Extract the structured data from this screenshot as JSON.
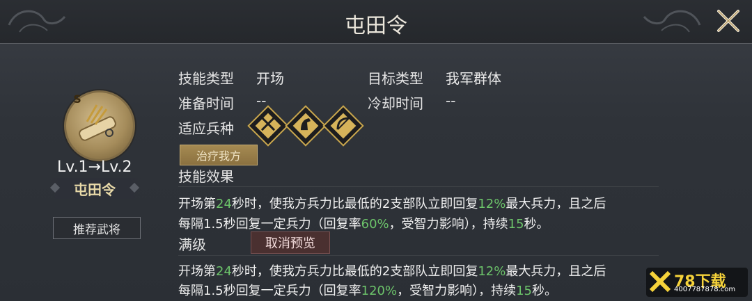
{
  "header": {
    "title": "屯田令"
  },
  "hero": {
    "level_text": "Lv.1→Lv.2",
    "name": "屯田令",
    "recommend_button": "推荐武将",
    "badge_letter": "S"
  },
  "details": {
    "skill_type_label": "技能类型",
    "skill_type_value": "开场",
    "target_type_label": "目标类型",
    "target_type_value": "我军群体",
    "prep_time_label": "准备时间",
    "prep_time_value": "--",
    "cooldown_label": "冷却时间",
    "cooldown_value": "--",
    "troop_label": "适应兵种",
    "troop_icons": [
      "spear-icon",
      "cavalry-icon",
      "bow-icon"
    ]
  },
  "tag": "治疗我方",
  "effect": {
    "label": "技能效果",
    "line1": [
      {
        "t": "开场第"
      },
      {
        "t": "24",
        "hl": true
      },
      {
        "t": "秒时，使我方兵力比最低的2支部队立即回复"
      },
      {
        "t": "12%",
        "hl": true
      },
      {
        "t": "最大兵力，且之后"
      }
    ],
    "line2": [
      {
        "t": "每隔1.5秒回复一定兵力（回复率"
      },
      {
        "t": "60%",
        "hl": true
      },
      {
        "t": "，受智力影响），持续"
      },
      {
        "t": "15",
        "hl": true
      },
      {
        "t": "秒。"
      }
    ]
  },
  "maxlevel": {
    "label": "满级",
    "cancel_button": "取消预览",
    "line1": [
      {
        "t": "开场第"
      },
      {
        "t": "24",
        "hl": true
      },
      {
        "t": "秒时，使我方兵力比最低的2支部队立即回复"
      },
      {
        "t": "12%",
        "hl": true
      },
      {
        "t": "最大兵力，且之后"
      }
    ],
    "line2": [
      {
        "t": "每隔1.5秒回复一定兵力（回复率"
      },
      {
        "t": "120%",
        "hl": true
      },
      {
        "t": "，受智力影响），持续"
      },
      {
        "t": "15",
        "hl": true
      },
      {
        "t": "秒。"
      }
    ]
  },
  "colors": {
    "highlight": "#6cc36a",
    "gold": "#c9a74e"
  },
  "watermark": {
    "brand": "78下载",
    "url": "4007787878.com"
  }
}
